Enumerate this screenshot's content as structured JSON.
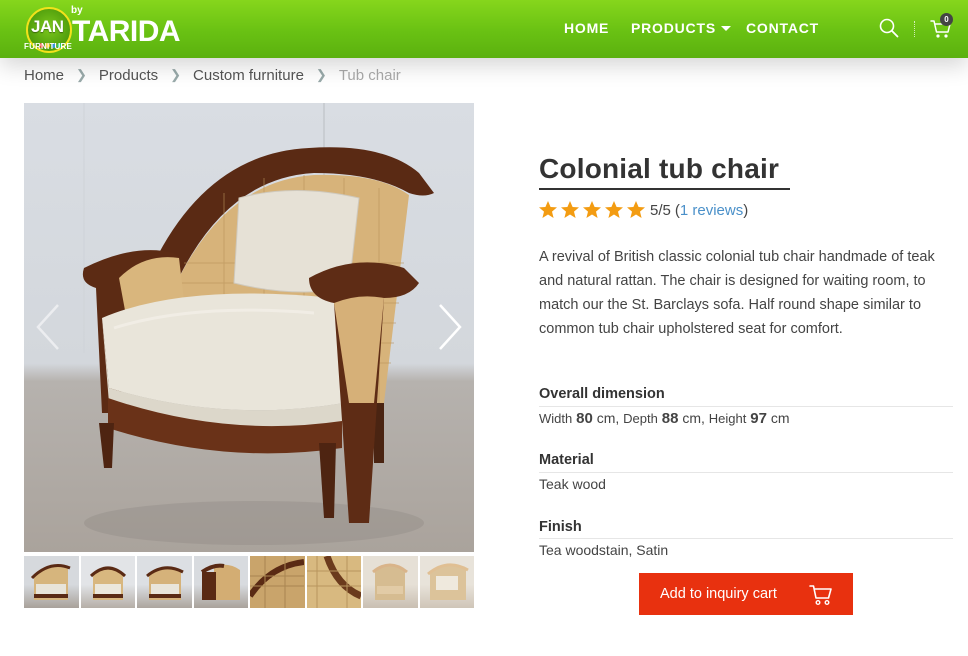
{
  "brand": {
    "logo_top": "JAN",
    "logo_sub": "FURNITURE",
    "logo_by": "by",
    "logo_name": "TARIDA"
  },
  "nav": {
    "items": [
      {
        "label": "HOME"
      },
      {
        "label": "PRODUCTS"
      },
      {
        "label": "CONTACT"
      }
    ],
    "cart_count": "0"
  },
  "breadcrumb": {
    "items": [
      "Home",
      "Products",
      "Custom furniture"
    ],
    "current": "Tub chair"
  },
  "product": {
    "title": "Colonial tub chair",
    "rating": {
      "stars": 5,
      "max": 5,
      "score_text": "5/5",
      "reviews_open": "(",
      "reviews_link": "1 reviews",
      "reviews_close": ")"
    },
    "description": "A revival of British classic colonial tub chair handmade of teak and natural rattan. The chair is designed for waiting room, to match our the St. Barclays sofa. Half round shape similar to common tub chair upholstered seat for comfort.",
    "specs": {
      "dimension_label": "Overall dimension",
      "width_label": "Width",
      "width_value": "80",
      "depth_label": "Depth",
      "depth_value": "88",
      "height_label": "Height",
      "height_value": "97",
      "unit": "cm",
      "material_label": "Material",
      "material_value": "Teak wood",
      "finish_label": "Finish",
      "finish_value": "Tea woodstain, Satin"
    },
    "cart_button": "Add to inquiry cart"
  },
  "colors": {
    "header_green": "#69c113",
    "accent_red": "#e8310f",
    "star_orange": "#f39c12",
    "link_blue": "#4a90c9"
  },
  "gallery": {
    "thumbnail_count": 8
  }
}
